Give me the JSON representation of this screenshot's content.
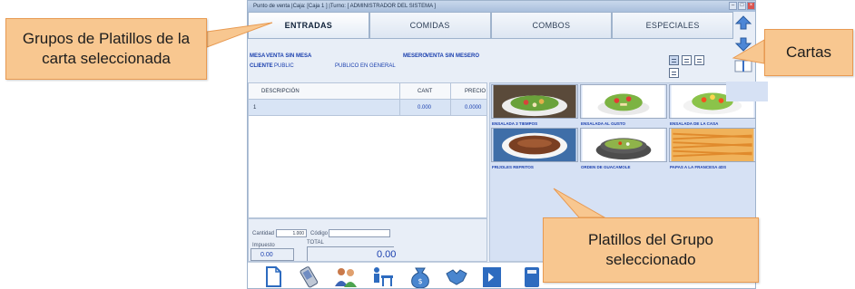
{
  "window": {
    "title": "Punto de venta  |Caja: [Caja 1 ]  |Turno: [ ADMINISTRADOR DEL SISTEMA ]"
  },
  "tabs": [
    {
      "label": "ENTRADAS"
    },
    {
      "label": "COMIDAS"
    },
    {
      "label": "COMBOS"
    },
    {
      "label": "ESPECIALES"
    }
  ],
  "info": {
    "mesa_label": "MESA",
    "mesa_value": "VENTA SIN MESA",
    "mesero_label": "MESERO",
    "mesero_value": "VENTA SIN MESERO",
    "cliente_label": "CLIENTE",
    "cliente_value": "PUBLIC",
    "cliente_name": "PUBLICO EN GENERAL"
  },
  "grid": {
    "columns": [
      "DESCRIPCIÓN",
      "CANT",
      "PRECIO"
    ],
    "rows": [
      {
        "index": "1",
        "description": "",
        "qty": "0.000",
        "price": "0.0000"
      }
    ]
  },
  "inputs": {
    "cantidad_label": "Cantidad",
    "cantidad_value": "1.000",
    "codigo_label": "Código",
    "codigo_value": "",
    "impuesto_label": "Impuesto",
    "impuesto_value": "0.00",
    "total_label": "TOTAL",
    "total_value": "0.00"
  },
  "dishes": [
    {
      "name": "ENSALADA 3 TIEMPOS"
    },
    {
      "name": "ENSALADA AL GUSTO"
    },
    {
      "name": "ENSALADA DE LA CASA"
    },
    {
      "name": "FRIJOLES REFRITOS"
    },
    {
      "name": "ORDEN DE GUACAMOLE"
    },
    {
      "name": "PAPAS A LA FRANCESA 4DS"
    }
  ],
  "toolbar": {
    "icons": [
      "new-document-icon",
      "phone-icon",
      "users-icon",
      "waiter-table-icon",
      "money-bag-icon",
      "handshake-icon",
      "exit-icon",
      "calculator-icon"
    ]
  },
  "callouts": {
    "grupos": "Grupos de Platillos de la carta seleccionada",
    "cartas": "Cartas",
    "platillos": "Platillos del Grupo seleccionado"
  },
  "colors": {
    "callout_fill": "#f8c790",
    "callout_border": "#e89a52",
    "accent_text": "#1a3fae",
    "panel_bg": "#d6e1f4"
  }
}
